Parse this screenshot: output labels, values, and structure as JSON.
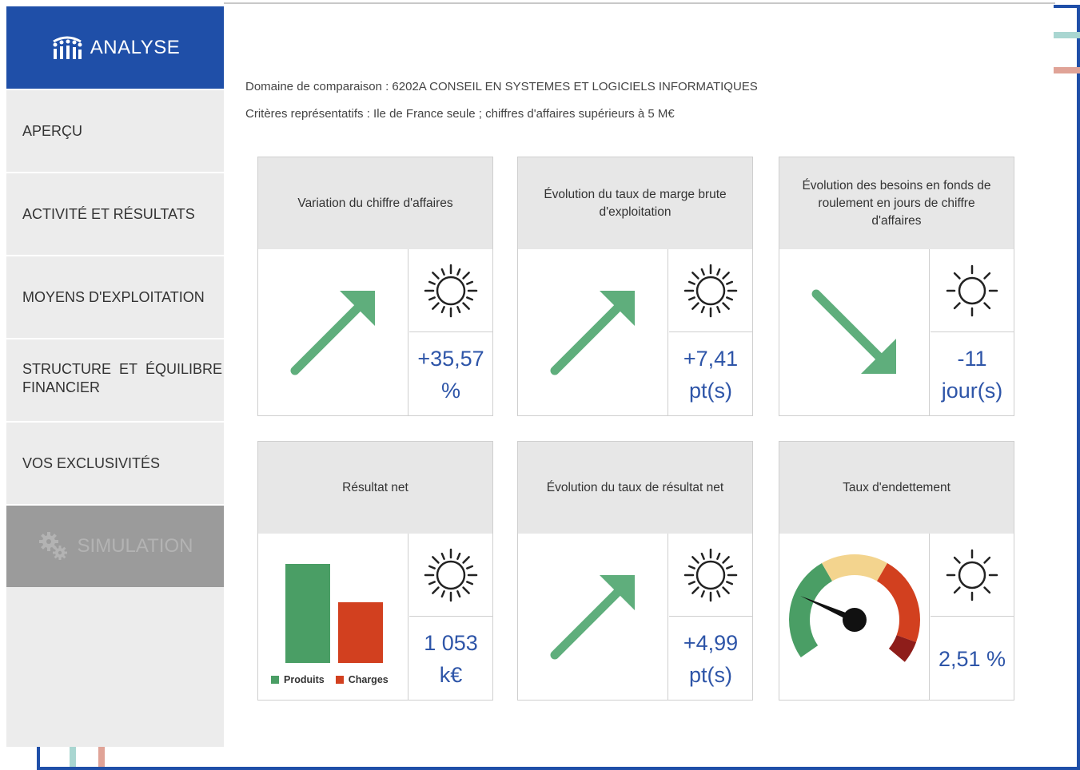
{
  "sidebar": {
    "title": "ANALYSE",
    "items": [
      {
        "label": "APERÇU"
      },
      {
        "label": "ACTIVITÉ ET RÉSULTATS"
      },
      {
        "label": "MOYENS D'EXPLOITATION"
      },
      {
        "label_words": [
          "STRUCTURE",
          "ET",
          "ÉQUILIBRE"
        ],
        "label_line2": "FINANCIER"
      },
      {
        "label": "VOS EXCLUSIVITÉS"
      }
    ],
    "simulation": "SIMULATION"
  },
  "header": {
    "domain": "Domaine de comparaison : 6202A CONSEIL EN SYSTEMES ET LOGICIELS INFORMATIQUES",
    "criteria": "Critères représentatifs : Ile de France seule ; chiffres d'affaires supérieurs à 5 M€"
  },
  "cards": [
    {
      "title": "Variation du chiffre d'affaires",
      "visual": "arrow-up",
      "weather": "sun-icon",
      "value_line1": "+35,57",
      "value_line2": "%"
    },
    {
      "title": "Évolution du taux de marge brute d'exploitation",
      "visual": "arrow-up",
      "weather": "sun-icon",
      "value_line1": "+7,41",
      "value_line2": "pt(s)"
    },
    {
      "title": "Évolution des besoins en fonds de roulement en jours de chiffre d'affaires",
      "visual": "arrow-down",
      "weather": "sun-icon",
      "value_line1": "-11",
      "value_line2": "jour(s)"
    },
    {
      "title": "Résultat net",
      "visual": "bar-chart",
      "weather": "sun-icon",
      "value_line1": "1 053",
      "value_line2": "k€",
      "chart": {
        "legend": [
          "Produits",
          "Charges"
        ],
        "colors": [
          "#4a9e65",
          "#d2401f"
        ]
      }
    },
    {
      "title": "Évolution du taux de résultat net",
      "visual": "arrow-up",
      "weather": "sun-icon",
      "value_line1": "+4,99",
      "value_line2": "pt(s)"
    },
    {
      "title": "Taux d'endettement",
      "visual": "gauge",
      "weather": "sun-icon",
      "value_line1": "2,51 %",
      "value_line2": ""
    }
  ],
  "colors": {
    "brand_blue": "#1f4fa8",
    "value_blue": "#2e55a8",
    "arrow_green": "#5fae7c",
    "gauge": [
      "#4a9e65",
      "#f3d48e",
      "#d2401f",
      "#8e1d1a"
    ]
  }
}
